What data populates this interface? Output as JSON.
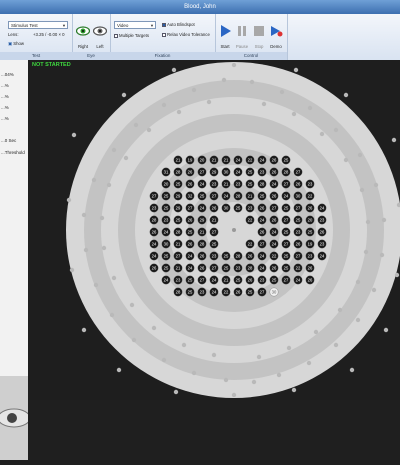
{
  "window": {
    "title": "Blood, John"
  },
  "ribbon": {
    "test_combo": "Stimulus Test",
    "lens_label": "Lens:",
    "lens_value": "+3.25 / -0.00 × 0",
    "show_label": "Show",
    "groups": {
      "test": "Test",
      "eye": "Eye",
      "fixation": "Fixation",
      "control": "Control"
    },
    "eye": {
      "right": "Right",
      "left": "Left"
    },
    "fixation": {
      "mode": "Video",
      "auto_blindspot": "Auto Blindspot",
      "multiple_targets": "Multiple Targets",
      "relax_video_tolerance": "Relax Video Tolerance"
    },
    "control": {
      "start": "Start",
      "pause": "Pause",
      "stop": "Stop",
      "demo": "Demo"
    }
  },
  "left_panel": {
    "lines": [
      "...04%",
      "...%",
      "...%",
      "...%",
      "...%",
      "...0 Sec",
      "...Threshold"
    ]
  },
  "field": {
    "status": "NOT STARTED",
    "colors": {
      "ring_light": "#d7d7d7",
      "ring_mid": "#c3c3c3",
      "stimulus": "#1a1a1a",
      "stimulus_text": "#ffffff",
      "pending": "#b9b9b9"
    },
    "labeled_points": [
      {
        "v": "21",
        "c": "dark"
      },
      {
        "v": "19",
        "c": "dark"
      },
      {
        "v": "20",
        "c": "dark"
      },
      {
        "v": "21",
        "c": "dark"
      },
      {
        "v": "21",
        "c": "dark"
      },
      {
        "v": "24",
        "c": "dark"
      },
      {
        "v": "22",
        "c": "dark"
      },
      {
        "v": "24",
        "c": "dark"
      },
      {
        "v": "26",
        "c": "dark"
      },
      {
        "v": "25",
        "c": "dark"
      },
      {
        "v": "31",
        "c": "dark"
      },
      {
        "v": "28",
        "c": "dark"
      },
      {
        "v": "26",
        "c": "dark"
      },
      {
        "v": "27",
        "c": "dark"
      },
      {
        "v": "29",
        "c": "dark"
      },
      {
        "v": "30",
        "c": "dark"
      },
      {
        "v": "24",
        "c": "dark"
      },
      {
        "v": "25",
        "c": "dark"
      },
      {
        "v": "23",
        "c": "dark"
      },
      {
        "v": "26",
        "c": "dark"
      },
      {
        "v": "28",
        "c": "dark"
      },
      {
        "v": "27",
        "c": "dark"
      },
      {
        "v": "20",
        "c": "dark"
      },
      {
        "v": "25",
        "c": "dark"
      },
      {
        "v": "26",
        "c": "dark"
      },
      {
        "v": "24",
        "c": "dark"
      },
      {
        "v": "23",
        "c": "dark"
      },
      {
        "v": "21",
        "c": "dark"
      },
      {
        "v": "23",
        "c": "dark"
      },
      {
        "v": "25",
        "c": "dark"
      },
      {
        "v": "28",
        "c": "dark"
      },
      {
        "v": "24",
        "c": "dark"
      },
      {
        "v": "27",
        "c": "dark"
      },
      {
        "v": "26",
        "c": "dark"
      },
      {
        "v": "23",
        "c": "dark"
      },
      {
        "v": "27",
        "c": "dark"
      },
      {
        "v": "25",
        "c": "dark"
      },
      {
        "v": "29",
        "c": "dark"
      },
      {
        "v": "32",
        "c": "dark"
      },
      {
        "v": "25",
        "c": "dark"
      },
      {
        "v": "27",
        "c": "dark"
      },
      {
        "v": "24",
        "c": "dark"
      },
      {
        "v": "28",
        "c": "dark"
      },
      {
        "v": "21",
        "c": "dark"
      },
      {
        "v": "25",
        "c": "dark"
      },
      {
        "v": "26",
        "c": "dark"
      },
      {
        "v": "24",
        "c": "dark"
      },
      {
        "v": "30",
        "c": "dark"
      },
      {
        "v": "22",
        "c": "dark"
      },
      {
        "v": "23",
        "c": "dark"
      },
      {
        "v": "25",
        "c": "dark"
      },
      {
        "v": "29",
        "c": "dark"
      },
      {
        "v": "27",
        "c": "dark"
      },
      {
        "v": "24",
        "c": "dark"
      },
      {
        "v": "26",
        "c": "dark"
      },
      {
        "v": "30",
        "c": "dark"
      },
      {
        "v": "25",
        "c": "dark"
      },
      {
        "v": "23",
        "c": "dark"
      },
      {
        "v": "26",
        "c": "dark"
      },
      {
        "v": "27",
        "c": "dark"
      },
      {
        "v": "25",
        "c": "dark"
      },
      {
        "v": "27",
        "c": "dark"
      },
      {
        "v": "26",
        "c": "dark"
      },
      {
        "v": "24",
        "c": "dark"
      },
      {
        "v": "28",
        "c": "dark"
      },
      {
        "v": "23",
        "c": "dark"
      },
      {
        "v": "25",
        "c": "dark"
      },
      {
        "v": "26",
        "c": "dark"
      },
      {
        "v": "29",
        "c": "dark"
      },
      {
        "v": "21",
        "c": "dark"
      },
      {
        "v": "22",
        "c": "dark"
      },
      {
        "v": "24",
        "c": "dark"
      },
      {
        "v": "26",
        "c": "dark"
      },
      {
        "v": "27",
        "c": "dark"
      },
      {
        "v": "25",
        "c": "dark"
      },
      {
        "v": "20",
        "c": "dark"
      },
      {
        "v": "23",
        "c": "dark"
      },
      {
        "v": "26",
        "c": "dark"
      },
      {
        "v": "24",
        "c": "dark"
      },
      {
        "v": "28",
        "c": "dark"
      },
      {
        "v": "25",
        "c": "dark"
      },
      {
        "v": "21",
        "c": "dark"
      },
      {
        "v": "27",
        "c": "dark"
      },
      {
        "v": "26",
        "c": "dark"
      },
      {
        "v": "24",
        "c": "dark"
      },
      {
        "v": "25",
        "c": "dark"
      },
      {
        "v": "23",
        "c": "dark"
      },
      {
        "v": "25",
        "c": "dark"
      },
      {
        "v": "26",
        "c": "dark"
      },
      {
        "v": "24",
        "c": "dark"
      },
      {
        "v": "30",
        "c": "dark"
      },
      {
        "v": "21",
        "c": "dark"
      },
      {
        "v": "26",
        "c": "dark"
      },
      {
        "v": "28",
        "c": "dark"
      },
      {
        "v": "25",
        "c": "dark"
      },
      {
        "v": "22",
        "c": "dark"
      },
      {
        "v": "27",
        "c": "dark"
      },
      {
        "v": "24",
        "c": "dark"
      },
      {
        "v": "27",
        "c": "dark"
      },
      {
        "v": "26",
        "c": "dark"
      },
      {
        "v": "19",
        "c": "dark"
      },
      {
        "v": "23",
        "c": "dark"
      },
      {
        "v": "24",
        "c": "dark"
      },
      {
        "v": "25",
        "c": "dark"
      },
      {
        "v": "27",
        "c": "dark"
      },
      {
        "v": "24",
        "c": "dark"
      },
      {
        "v": "26",
        "c": "dark"
      },
      {
        "v": "23",
        "c": "dark"
      },
      {
        "v": "25",
        "c": "dark"
      },
      {
        "v": "28",
        "c": "dark"
      },
      {
        "v": "26",
        "c": "dark"
      },
      {
        "v": "24",
        "c": "dark"
      },
      {
        "v": "22",
        "c": "dark"
      },
      {
        "v": "25",
        "c": "dark"
      },
      {
        "v": "27",
        "c": "dark"
      },
      {
        "v": "23",
        "c": "dark"
      },
      {
        "v": "24",
        "c": "dark"
      },
      {
        "v": "26",
        "c": "dark"
      },
      {
        "v": "25",
        "c": "dark"
      },
      {
        "v": "21",
        "c": "dark"
      },
      {
        "v": "24",
        "c": "dark"
      },
      {
        "v": "26",
        "c": "dark"
      },
      {
        "v": "27",
        "c": "dark"
      },
      {
        "v": "25",
        "c": "dark"
      },
      {
        "v": "23",
        "c": "dark"
      },
      {
        "v": "28",
        "c": "dark"
      },
      {
        "v": "24",
        "c": "dark"
      },
      {
        "v": "26",
        "c": "dark"
      },
      {
        "v": "25",
        "c": "dark"
      },
      {
        "v": "22",
        "c": "dark"
      },
      {
        "v": "26",
        "c": "dark"
      },
      {
        "v": "24",
        "c": "dark"
      },
      {
        "v": "23",
        "c": "dark"
      },
      {
        "v": "25",
        "c": "dark"
      },
      {
        "v": "27",
        "c": "dark"
      },
      {
        "v": "24",
        "c": "dark"
      },
      {
        "v": "21",
        "c": "dark"
      },
      {
        "v": "25",
        "c": "dark"
      },
      {
        "v": "26",
        "c": "dark"
      },
      {
        "v": "23",
        "c": "dark"
      },
      {
        "v": "25",
        "c": "dark"
      },
      {
        "v": "27",
        "c": "dark"
      },
      {
        "v": "24",
        "c": "dark"
      },
      {
        "v": "26",
        "c": "dark"
      },
      {
        "v": "28",
        "c": "dark"
      },
      {
        "v": "25",
        "c": "dark"
      },
      {
        "v": "23",
        "c": "dark"
      },
      {
        "v": "24",
        "c": "dark"
      },
      {
        "v": "22",
        "c": "dark"
      },
      {
        "v": "26",
        "c": "dark"
      },
      {
        "v": "25",
        "c": "dark"
      },
      {
        "v": "27",
        "c": "dark"
      },
      {
        "v": "30",
        "c": "pending"
      }
    ]
  }
}
